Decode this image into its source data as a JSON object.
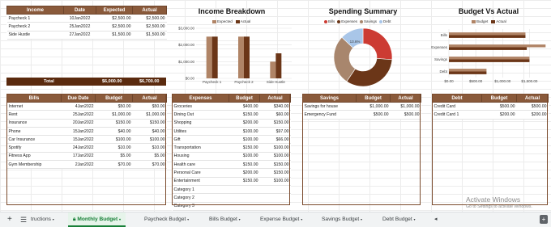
{
  "income_table": {
    "headers": [
      "Income",
      "Date",
      "Expected",
      "Actual"
    ],
    "rows": [
      [
        "Paycheck 1",
        "10Jan2022",
        "$2,500.00",
        "$2,500.00"
      ],
      [
        "Paycheck 2",
        "25Jan2022",
        "$2,500.00",
        "$2,500.00"
      ],
      [
        "Side Hustle",
        "27Jan2022",
        "$1,500.00",
        "$1,500.00"
      ]
    ],
    "total_label": "Total",
    "total_expected": "$6,000.00",
    "total_actual": "$6,700.00"
  },
  "bills_table": {
    "headers": [
      "Bills",
      "Due Date",
      "Budget",
      "Actual"
    ],
    "rows": [
      [
        "Internet",
        "4Jan2022",
        "$50.00",
        "$50.00"
      ],
      [
        "Rent",
        "25Jan2022",
        "$1,000.00",
        "$1,000.00"
      ],
      [
        "Insurance",
        "20Jan2022",
        "$150.00",
        "$150.00"
      ],
      [
        "Phone",
        "15Jan2022",
        "$40.00",
        "$40.00"
      ],
      [
        "Car Insurance",
        "15Jan2022",
        "$100.00",
        "$100.00"
      ],
      [
        "Spotify",
        "24Jan2022",
        "$10.00",
        "$10.00"
      ],
      [
        "Fitness App",
        "17Jan2022",
        "$5.00",
        "$5.00"
      ],
      [
        "Gym Membership",
        "2Jan2022",
        "$70.00",
        "$70.00"
      ]
    ]
  },
  "expenses_table": {
    "headers": [
      "Expenses",
      "Budget",
      "Actual"
    ],
    "rows": [
      [
        "Groceries",
        "$400.00",
        "$340.00"
      ],
      [
        "Dining Out",
        "$150.00",
        "$60.00"
      ],
      [
        "Shopping",
        "$200.00",
        "$150.00"
      ],
      [
        "Utilites",
        "$100.00",
        "$97.00"
      ],
      [
        "Gift",
        "$100.00",
        "$66.00"
      ],
      [
        "Transportation",
        "$150.00",
        "$100.00"
      ],
      [
        "Housing",
        "$100.00",
        "$100.00"
      ],
      [
        "Health care",
        "$150.00",
        "$150.00"
      ],
      [
        "Personal Care",
        "$200.00",
        "$150.00"
      ],
      [
        "Entertainment",
        "$150.00",
        "$100.00"
      ],
      [
        "Category 1",
        "",
        ""
      ],
      [
        "Category 2",
        "",
        ""
      ],
      [
        "Category 3",
        "",
        ""
      ],
      [
        "Category 4",
        "",
        ""
      ]
    ]
  },
  "savings_table": {
    "headers": [
      "Savings",
      "Budget",
      "Actual"
    ],
    "rows": [
      [
        "Savings for house",
        "$1,000.00",
        "$1,000.00"
      ],
      [
        "Emergency Fund",
        "$500.00",
        "$500.00"
      ]
    ]
  },
  "debt_table": {
    "headers": [
      "Debt",
      "Budget",
      "Actual"
    ],
    "rows": [
      [
        "Credit Card",
        "$500.00",
        "$500.00"
      ],
      [
        "Credit Card 1",
        "$200.00",
        "$200.00"
      ]
    ]
  },
  "chart_data": [
    {
      "type": "bar",
      "title": "Income Breakdown",
      "categories": [
        "Paycheck 1",
        "Paycheck 2",
        "Side Hustle"
      ],
      "series": [
        {
          "name": "Expected",
          "values": [
            2500,
            2500,
            1000
          ]
        },
        {
          "name": "Actual",
          "values": [
            2500,
            2500,
            1500
          ]
        }
      ],
      "ylim": [
        0,
        3000
      ],
      "yticks": [
        "$3,000.00",
        "$2,000.00",
        "$1,000.00",
        "$0.00"
      ],
      "ytick_values": [
        3000,
        2000,
        1000,
        0
      ],
      "colors": [
        "#b08466",
        "#6b3618"
      ],
      "legend": "top"
    },
    {
      "type": "pie",
      "title": "Spending Summary",
      "categories": [
        "Bills",
        "Expenses",
        "Savings",
        "Debt"
      ],
      "values": [
        1425,
        1800,
        1500,
        700
      ],
      "labels": [
        "13.6%"
      ],
      "colors": [
        "#cc3b33",
        "#6b3618",
        "#a8866d",
        "#a9c6e8"
      ],
      "legend": "top"
    },
    {
      "type": "bar",
      "title": "Budget Vs Actual",
      "orientation": "horizontal",
      "categories": [
        "Bills",
        "Expenses",
        "Savings",
        "Debt"
      ],
      "series": [
        {
          "name": "Budget",
          "values": [
            1425,
            1800,
            1500,
            700
          ]
        },
        {
          "name": "Actual",
          "values": [
            1425,
            1450,
            1500,
            700
          ]
        }
      ],
      "xlim": [
        0,
        1750
      ],
      "xticks": [
        "$0.00",
        "$500.00",
        "$1,000.00",
        "$1,500.00"
      ],
      "xtick_values": [
        0,
        500,
        1000,
        1500
      ],
      "colors": [
        "#b08466",
        "#6b3618"
      ],
      "legend": "top"
    }
  ],
  "sheet_tabs": {
    "add_icon": "plus-icon",
    "menu_icon": "list-icon",
    "tabs": [
      "tructions",
      "Monthly Budget",
      "Paycheck Budget",
      "Bills Budget",
      "Expense Budget",
      "Savings Budget",
      "Debt Budget"
    ],
    "active": "Monthly Budget",
    "active_color": "#188038"
  },
  "watermark": {
    "line1": "Activate Windows",
    "line2": "Go to Settings to activate Windows."
  }
}
